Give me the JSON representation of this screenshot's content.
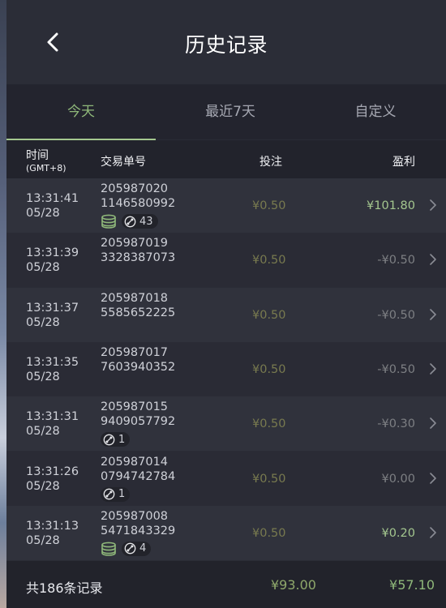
{
  "header": {
    "title": "历史记录"
  },
  "tabs": [
    {
      "label": "今天",
      "active": true
    },
    {
      "label": "最近7天",
      "active": false
    },
    {
      "label": "自定义",
      "active": false
    }
  ],
  "columns": {
    "time": "时间",
    "timezone": "(GMT+8)",
    "order": "交易单号",
    "bet": "投注",
    "profit": "盈利"
  },
  "rows": [
    {
      "time": "13:31:41",
      "date": "05/28",
      "order1": "205987020",
      "order2": "1146580992",
      "bet": "¥0.50",
      "profit": "¥101.80",
      "positive": true,
      "coin": true,
      "badge": "43"
    },
    {
      "time": "13:31:39",
      "date": "05/28",
      "order1": "205987019",
      "order2": "3328387073",
      "bet": "¥0.50",
      "profit": "-¥0.50",
      "positive": false,
      "coin": false,
      "badge": null
    },
    {
      "time": "13:31:37",
      "date": "05/28",
      "order1": "205987018",
      "order2": "5585652225",
      "bet": "¥0.50",
      "profit": "-¥0.50",
      "positive": false,
      "coin": false,
      "badge": null
    },
    {
      "time": "13:31:35",
      "date": "05/28",
      "order1": "205987017",
      "order2": "7603940352",
      "bet": "¥0.50",
      "profit": "-¥0.50",
      "positive": false,
      "coin": false,
      "badge": null
    },
    {
      "time": "13:31:31",
      "date": "05/28",
      "order1": "205987015",
      "order2": "9409057792",
      "bet": "¥0.50",
      "profit": "-¥0.30",
      "positive": false,
      "coin": false,
      "badge": "1"
    },
    {
      "time": "13:31:26",
      "date": "05/28",
      "order1": "205987014",
      "order2": "0794742784",
      "bet": "¥0.50",
      "profit": "¥0.00",
      "positive": false,
      "coin": false,
      "badge": "1"
    },
    {
      "time": "13:31:13",
      "date": "05/28",
      "order1": "205987008",
      "order2": "5471843329",
      "bet": "¥0.50",
      "profit": "¥0.20",
      "positive": true,
      "coin": true,
      "badge": "4"
    }
  ],
  "footer": {
    "count": "共186条记录",
    "total_bet": "¥93.00",
    "total_profit": "¥57.10"
  },
  "colors": {
    "accent_green": "#8fb87a",
    "bet_olive": "#787a4f",
    "negative_gray": "#7d7f83"
  },
  "icons": {
    "back": "chevron-left-icon",
    "row": "chevron-right-icon",
    "coin": "coin-stack-icon",
    "badge": "free-spin-icon"
  }
}
